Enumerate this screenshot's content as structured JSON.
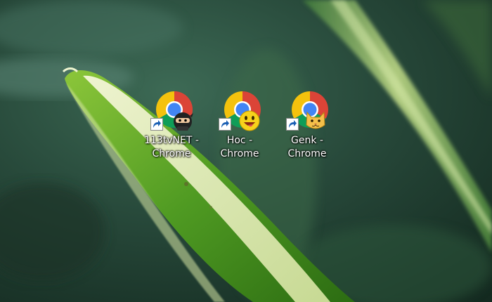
{
  "desktop": {
    "icons": [
      {
        "label": "113tvNET -\nChrome",
        "badge_icon": "ninja-icon",
        "app_icon": "chrome-icon",
        "overlay_icon": "shortcut-arrow-icon"
      },
      {
        "label": "Hoc -\nChrome",
        "badge_icon": "smiley-face-icon",
        "app_icon": "chrome-icon",
        "overlay_icon": "shortcut-arrow-icon"
      },
      {
        "label": "Genk -\nChrome",
        "badge_icon": "cat-face-icon",
        "app_icon": "chrome-icon",
        "overlay_icon": "shortcut-arrow-icon"
      }
    ]
  },
  "colors": {
    "chrome_red": "#db4437",
    "chrome_yellow": "#f4c20d",
    "chrome_green": "#0f9d58",
    "chrome_blue": "#4285f4",
    "label_text": "#ffffff"
  }
}
